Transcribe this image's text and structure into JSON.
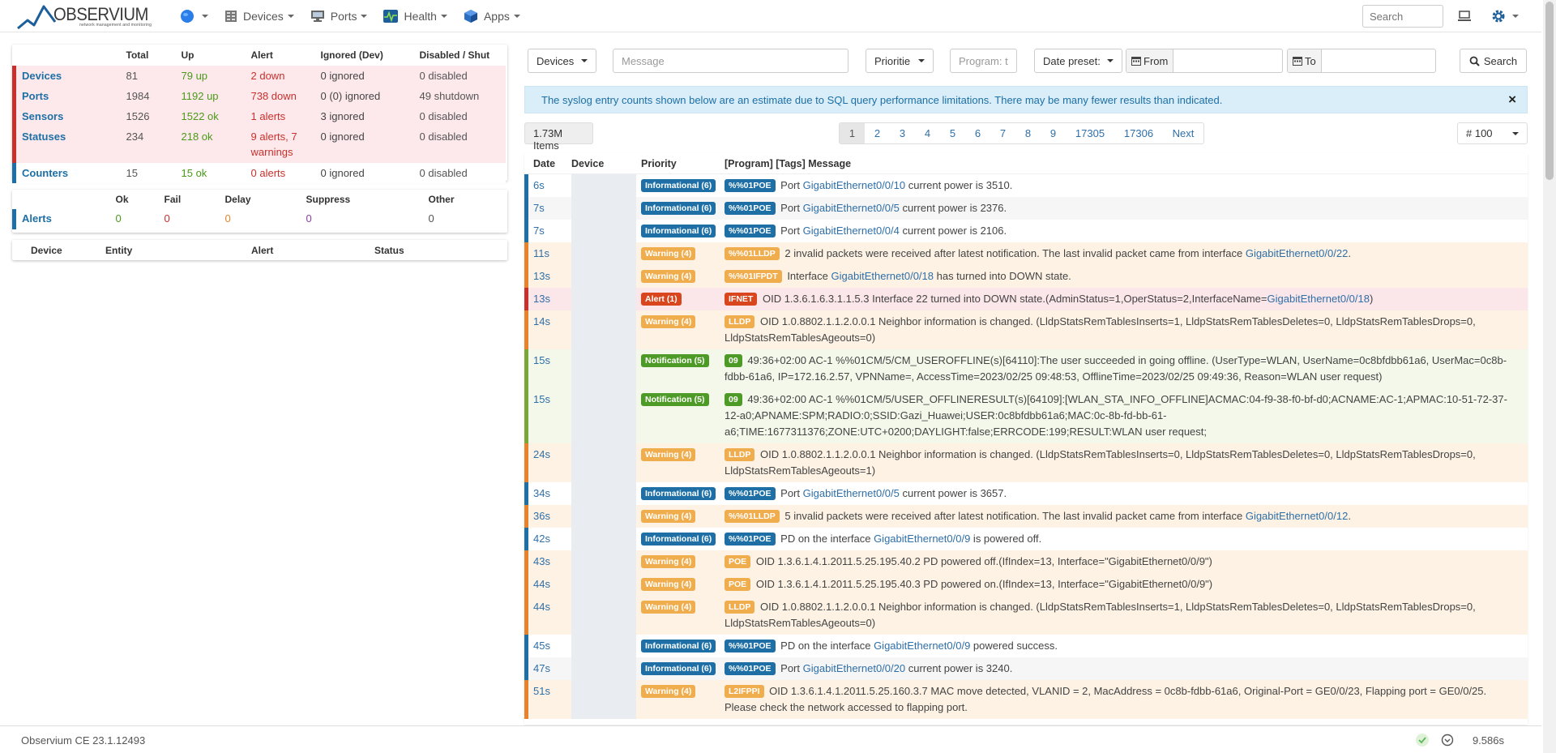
{
  "brand": {
    "name": "OBSERVIUM",
    "tagline": "network management and monitoring"
  },
  "nav": {
    "items": [
      {
        "label": "Devices",
        "icon": "server-icon"
      },
      {
        "label": "Ports",
        "icon": "monitor-icon"
      },
      {
        "label": "Health",
        "icon": "pulse-icon"
      },
      {
        "label": "Apps",
        "icon": "cube-icon"
      }
    ],
    "search_placeholder": "Search"
  },
  "summary": {
    "headers": [
      "",
      "Total",
      "Up",
      "Alert",
      "Ignored (Dev)",
      "Disabled / Shut"
    ],
    "rows": [
      {
        "label": "Devices",
        "total": "81",
        "up": "79 up",
        "alert": "2 down",
        "ignored": "0 ignored",
        "disabled": "0 disabled"
      },
      {
        "label": "Ports",
        "total": "1984",
        "up": "1192 up",
        "alert": "738 down",
        "ignored": "0 (0) ignored",
        "disabled": "49 shutdown"
      },
      {
        "label": "Sensors",
        "total": "1526",
        "up": "1522 ok",
        "alert": "1 alerts",
        "ignored": "3 ignored",
        "disabled": "0 disabled"
      },
      {
        "label": "Statuses",
        "total": "234",
        "up": "218 ok",
        "alert": "9 alerts, 7 warnings",
        "ignored": "0 ignored",
        "disabled": "0 disabled"
      },
      {
        "label": "Counters",
        "total": "15",
        "up": "15 ok",
        "alert": "0 alerts",
        "ignored": "0 ignored",
        "disabled": "0 disabled"
      }
    ]
  },
  "alerts": {
    "headers": [
      "",
      "Ok",
      "Fail",
      "Delay",
      "Suppress",
      "Other"
    ],
    "label": "Alerts",
    "ok": "0",
    "fail": "0",
    "delay": "0",
    "suppress": "0",
    "other": "0"
  },
  "entity_headers": [
    "Device",
    "Entity",
    "Alert",
    "Status"
  ],
  "filters": {
    "devices": "Devices",
    "message_placeholder": "Message",
    "priorities": "Prioritie",
    "program_placeholder": "Program: t",
    "date_presets": "Date preset:",
    "from": "From",
    "to": "To",
    "search": "Search"
  },
  "info": "The syslog entry counts shown below are an estimate due to SQL query performance limitations. There may be many fewer results than indicated.",
  "items_count": "1.73M Items",
  "pages": [
    "1",
    "2",
    "3",
    "4",
    "5",
    "6",
    "7",
    "8",
    "9",
    "17305",
    "17306",
    "Next"
  ],
  "per_page": "# 100",
  "log_headers": [
    "Date",
    "Device",
    "Priority",
    "[Program] [Tags] Message"
  ],
  "colors": {
    "info": "#1d6fa5",
    "warning": "#f0ad4e",
    "alert": "#d9461e",
    "notification": "#4e9a26"
  },
  "logs": [
    {
      "date": "6s",
      "level": "info",
      "priority": "Informational (6)",
      "tag": "%%01POE",
      "pre": "Port ",
      "link": "GigabitEthernet0/0/10",
      "post": " current power is 3510."
    },
    {
      "date": "7s",
      "level": "info",
      "priority": "Informational (6)",
      "tag": "%%01POE",
      "pre": "Port ",
      "link": "GigabitEthernet0/0/5",
      "post": " current power is 2376."
    },
    {
      "date": "7s",
      "level": "info",
      "priority": "Informational (6)",
      "tag": "%%01POE",
      "pre": "Port ",
      "link": "GigabitEthernet0/0/4",
      "post": " current power is 2106."
    },
    {
      "date": "11s",
      "level": "warn",
      "priority": "Warning (4)",
      "tag": "%%01LLDP",
      "pre": "2 invalid packets were received after latest notification. The last invalid packet came from interface ",
      "link": "GigabitEthernet0/0/22",
      "post": "."
    },
    {
      "date": "13s",
      "level": "warn",
      "priority": "Warning (4)",
      "tag": "%%01IFPDT",
      "pre": "Interface ",
      "link": "GigabitEthernet0/0/18",
      "post": " has turned into DOWN state."
    },
    {
      "date": "13s",
      "level": "alert",
      "priority": "Alert (1)",
      "tag": "IFNET",
      "pre": "OID 1.3.6.1.6.3.1.1.5.3 Interface 22 turned into DOWN state.(AdminStatus=1,OperStatus=2,InterfaceName=",
      "link": "GigabitEthernet0/0/18",
      "post": ")"
    },
    {
      "date": "14s",
      "level": "warn",
      "priority": "Warning (4)",
      "tag": "LLDP",
      "pre": "OID 1.0.8802.1.1.2.0.0.1 Neighbor information is changed. (LldpStatsRemTablesInserts=1, LldpStatsRemTablesDeletes=0, LldpStatsRemTablesDrops=0, LldpStatsRemTablesAgeouts=0)",
      "link": "",
      "post": ""
    },
    {
      "date": "15s",
      "level": "notif",
      "priority": "Notification (5)",
      "tag": "09",
      "pre": "49:36+02:00 AC-1 %%01CM/5/CM_USEROFFLINE(s)[64110]:The user succeeded in going offline. (UserType=WLAN, UserName=0c8bfdbb61a6, UserMac=0c8b-fdbb-61a6, IP=172.16.2.57, VPNName=, AccessTime=2023/02/25 09:48:53, OfflineTime=2023/02/25 09:49:36, Reason=WLAN user request)",
      "link": "",
      "post": ""
    },
    {
      "date": "15s",
      "level": "notif",
      "priority": "Notification (5)",
      "tag": "09",
      "pre": "49:36+02:00 AC-1 %%01CM/5/USER_OFFLINERESULT(s)[64109]:[WLAN_STA_INFO_OFFLINE]ACMAC:04-f9-38-f0-bf-d0;ACNAME:AC-1;APMAC:10-51-72-37-12-a0;APNAME:SPM;RADIO:0;SSID:Gazi_Huawei;USER:0c8bfdbb61a6;MAC:0c-8b-fd-bb-61-a6;TIME:1677311376;ZONE:UTC+0200;DAYLIGHT:false;ERRCODE:199;RESULT:WLAN user request;",
      "link": "",
      "post": ""
    },
    {
      "date": "24s",
      "level": "warn",
      "priority": "Warning (4)",
      "tag": "LLDP",
      "pre": "OID 1.0.8802.1.1.2.0.0.1 Neighbor information is changed. (LldpStatsRemTablesInserts=0, LldpStatsRemTablesDeletes=0, LldpStatsRemTablesDrops=0, LldpStatsRemTablesAgeouts=1)",
      "link": "",
      "post": ""
    },
    {
      "date": "34s",
      "level": "info",
      "priority": "Informational (6)",
      "tag": "%%01POE",
      "pre": "Port ",
      "link": "GigabitEthernet0/0/5",
      "post": " current power is 3657."
    },
    {
      "date": "36s",
      "level": "warn",
      "priority": "Warning (4)",
      "tag": "%%01LLDP",
      "pre": "5 invalid packets were received after latest notification. The last invalid packet came from interface ",
      "link": "GigabitEthernet0/0/12",
      "post": "."
    },
    {
      "date": "42s",
      "level": "info",
      "priority": "Informational (6)",
      "tag": "%%01POE",
      "pre": "PD on the interface ",
      "link": "GigabitEthernet0/0/9",
      "post": " is powered off."
    },
    {
      "date": "43s",
      "level": "warn",
      "priority": "Warning (4)",
      "tag": "POE",
      "pre": "OID 1.3.6.1.4.1.2011.5.25.195.40.2 PD powered off.(IfIndex=13, Interface=\"GigabitEthernet0/0/9\")",
      "link": "",
      "post": ""
    },
    {
      "date": "44s",
      "level": "warn",
      "priority": "Warning (4)",
      "tag": "POE",
      "pre": "OID 1.3.6.1.4.1.2011.5.25.195.40.3 PD powered on.(IfIndex=13, Interface=\"GigabitEthernet0/0/9\")",
      "link": "",
      "post": ""
    },
    {
      "date": "44s",
      "level": "warn",
      "priority": "Warning (4)",
      "tag": "LLDP",
      "pre": "OID 1.0.8802.1.1.2.0.0.1 Neighbor information is changed. (LldpStatsRemTablesInserts=1, LldpStatsRemTablesDeletes=0, LldpStatsRemTablesDrops=0, LldpStatsRemTablesAgeouts=0)",
      "link": "",
      "post": ""
    },
    {
      "date": "45s",
      "level": "info",
      "priority": "Informational (6)",
      "tag": "%%01POE",
      "pre": "PD on the interface ",
      "link": "GigabitEthernet0/0/9",
      "post": " powered success."
    },
    {
      "date": "47s",
      "level": "info",
      "priority": "Informational (6)",
      "tag": "%%01POE",
      "pre": "Port ",
      "link": "GigabitEthernet0/0/20",
      "post": " current power is 3240."
    },
    {
      "date": "51s",
      "level": "warn",
      "priority": "Warning (4)",
      "tag": "L2IFPPI",
      "pre": "OID 1.3.6.1.4.1.2011.5.25.160.3.7 MAC move detected, VLANID = 2, MacAddress = 0c8b-fdbb-61a6, Original-Port = GE0/0/23, Flapping port = GE0/0/25. Please check the network accessed to flapping port.",
      "link": "",
      "post": ""
    }
  ],
  "footer": {
    "version": "Observium CE 23.1.12493",
    "time": "9.586s"
  }
}
